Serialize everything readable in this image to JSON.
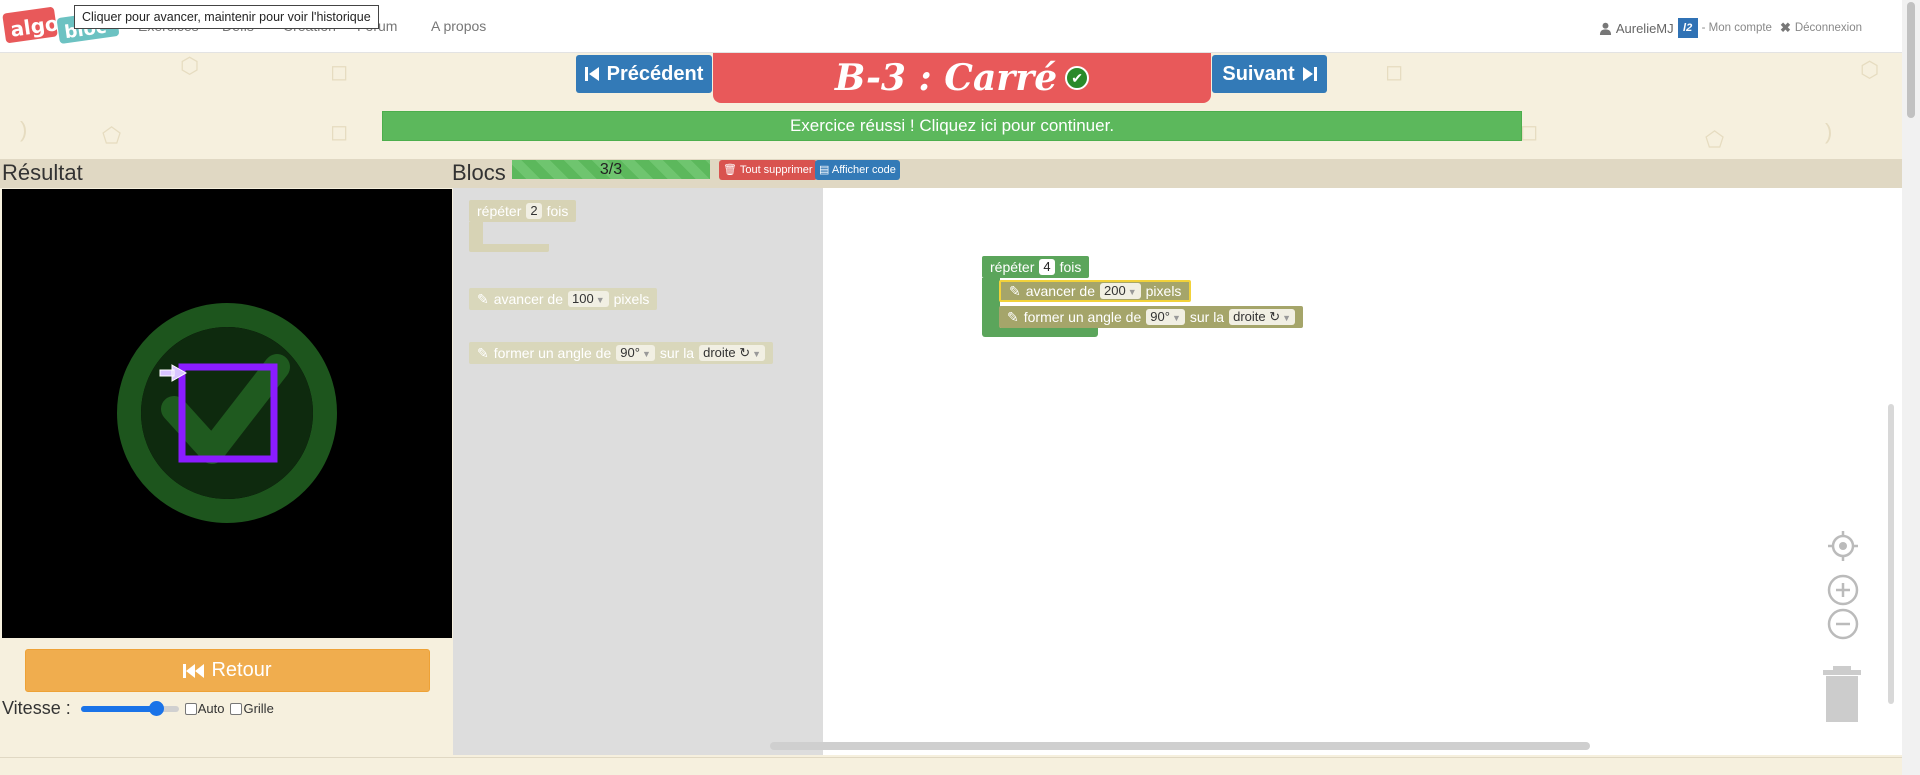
{
  "nav": {
    "logo_text": "algo.bloc",
    "links": [
      "Exercices",
      "Défis",
      "Création",
      "Forum",
      "A propos"
    ],
    "tooltip": "Cliquer pour avancer, maintenir pour voir l'historique",
    "user": "AurelieMJ",
    "badge": "l2",
    "account": "- Mon compte",
    "logout": "Déconnexion"
  },
  "exercise": {
    "prev": "Précédent",
    "next": "Suivant",
    "title": "B-3 : Carré",
    "success": "Exercice réussi ! Cliquez ici pour continuer."
  },
  "left": {
    "heading": "Résultat",
    "back": "Retour",
    "speed_label": "Vitesse :",
    "speed_value": 0.75,
    "auto": "Auto",
    "grid": "Grille"
  },
  "blocks": {
    "heading": "Blocs",
    "progress": "3/3",
    "delete_all": "Tout supprimer",
    "show_code": "Afficher code"
  },
  "toolbox": {
    "repeat": {
      "pre": "répéter",
      "n": "2",
      "post": "fois"
    },
    "advance": {
      "pre": "avancer de",
      "v": "100",
      "post": "pixels"
    },
    "turn": {
      "pre": "former un angle de",
      "a": "90°",
      "mid": "sur la",
      "dir": "droite ↻"
    }
  },
  "workspace": {
    "repeat": {
      "pre": "répéter",
      "n": "4",
      "post": "fois"
    },
    "advance": {
      "pre": "avancer de",
      "v": "200",
      "post": "pixels"
    },
    "turn": {
      "pre": "former un angle de",
      "a": "90°",
      "mid": "sur la",
      "dir": "droite ↻"
    }
  },
  "colors": {
    "primary": "#337ab7",
    "title_bg": "#e8595a",
    "success": "#5cb85c",
    "warning": "#f0ad4e",
    "draw": "#8a1cff"
  }
}
